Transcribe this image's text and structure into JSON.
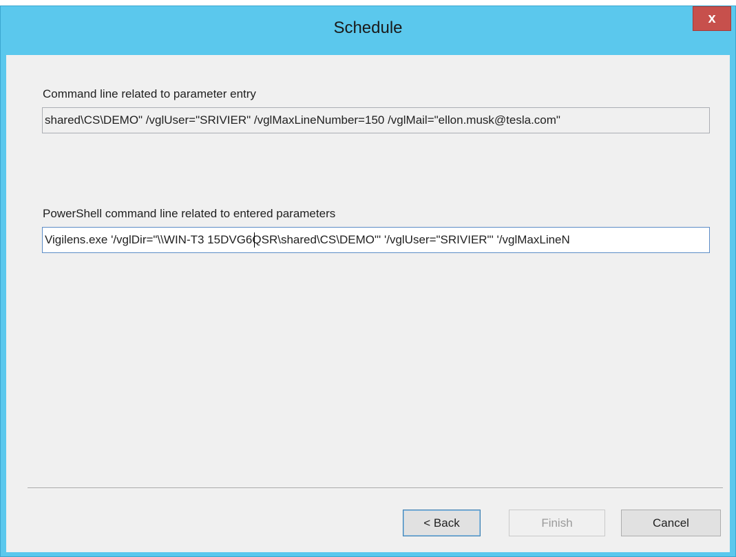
{
  "window": {
    "title": "Schedule",
    "close_label": "x"
  },
  "section1": {
    "label": "Command line related to parameter entry",
    "value": "shared\\CS\\DEMO\" /vglUser=\"SRIVIER\" /vglMaxLineNumber=150 /vglMail=\"ellon.musk@tesla.com\""
  },
  "section2": {
    "label": "PowerShell command line related to entered parameters",
    "value": "Vigilens.exe '/vglDir=\"\\\\WIN-T3 15DVG6QSR\\shared\\CS\\DEMO\"' '/vglUser=\"SRIVIER\"' '/vglMaxLineN"
  },
  "buttons": {
    "back": "< Back",
    "finish": "Finish",
    "cancel": "Cancel"
  }
}
